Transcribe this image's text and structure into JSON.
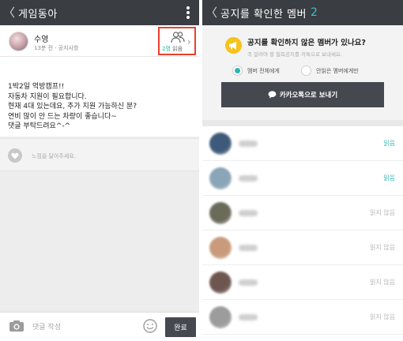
{
  "left": {
    "header": {
      "back": "〈",
      "title": "게임동아"
    },
    "post": {
      "author": "수영",
      "meta": "13분 전 · 공지사항",
      "readers": {
        "count": "2명",
        "label": "읽음"
      },
      "lines": [
        "1박2일 먹방캠프!!",
        "자동차 지원이 필요합니다.",
        "현재 4대 있는데요, 추가 지원 가능하신 분?",
        "연비 많이 안 드는 차량이 좋습니다~",
        "댓글 부탁드려요^-^"
      ]
    },
    "like_prompt": "느낌을 달아주세요.",
    "composer": {
      "placeholder": "댓글 작성",
      "done": "완료"
    }
  },
  "right": {
    "header": {
      "back": "〈",
      "title": "공지를 확인한 멤버",
      "count": "2"
    },
    "notice": {
      "title": "공지를 확인하지 않은 멤버가 있나요?",
      "subtitle": "꼭 알려야 할 필독공지를 카톡으로 보내세요.",
      "options": [
        {
          "label": "멤버 전체에게",
          "selected": true
        },
        {
          "label": "안읽은 멤버에게만",
          "selected": false
        }
      ],
      "send_button": "카카오톡으로 보내기"
    },
    "members": [
      {
        "status": "읽음",
        "read": true,
        "avatar": "#3d5a7a"
      },
      {
        "status": "읽음",
        "read": true,
        "avatar": "#8aa4b8"
      },
      {
        "status": "읽지 않음",
        "read": false,
        "avatar": "#6b6b5a"
      },
      {
        "status": "읽지 않음",
        "read": false,
        "avatar": "#c99b7c"
      },
      {
        "status": "읽지 않음",
        "read": false,
        "avatar": "#6e5650"
      },
      {
        "status": "읽지 않음",
        "read": false,
        "avatar": "#9c9c9c"
      }
    ]
  },
  "colors": {
    "header_bg": "#3a3d42",
    "accent_teal": "#2bb3b0",
    "highlight_red": "#e8412b",
    "button_dark": "#45484f",
    "megaphone_yellow": "#f7c31a"
  }
}
